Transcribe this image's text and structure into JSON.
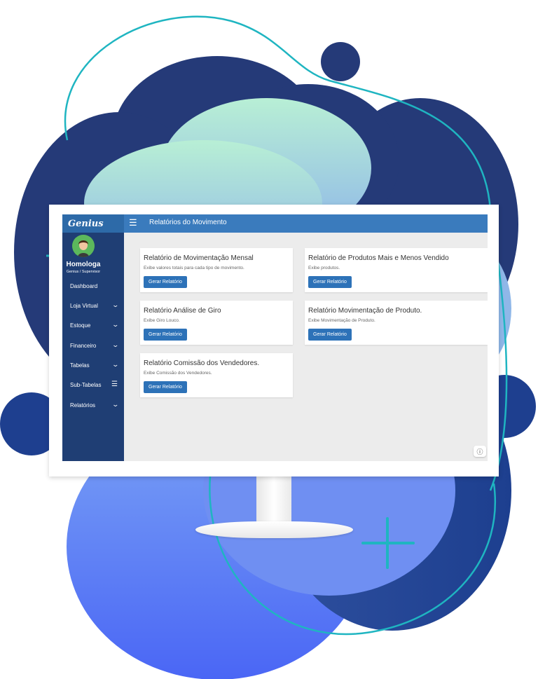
{
  "app": {
    "logo": "Genius",
    "page_title": "Relatórios do Movimento"
  },
  "user": {
    "name": "Homologa",
    "role": "Genius / Supervisor"
  },
  "sidebar": {
    "items": [
      {
        "label": "Dashboard",
        "icon": "none"
      },
      {
        "label": "Loja Virtual",
        "icon": "chevron-down-icon"
      },
      {
        "label": "Estoque",
        "icon": "chevron-down-icon"
      },
      {
        "label": "Financeiro",
        "icon": "chevron-down-icon"
      },
      {
        "label": "Tabelas",
        "icon": "chevron-down-icon"
      },
      {
        "label": "Sub-Tabelas",
        "icon": "bars-icon"
      },
      {
        "label": "Relatórios",
        "icon": "chevron-down-icon"
      }
    ]
  },
  "reports": [
    {
      "title": "Relatório de Movimentação Mensal",
      "description": "Exibe valores totais para cada tipo de movimento.",
      "button": "Gerar Relatório"
    },
    {
      "title": "Relatório de Produtos Mais e Menos Vendido",
      "description": "Exibe produtos.",
      "button": "Gerar Relatório"
    },
    {
      "title": "Relatório Análise de Giro",
      "description": "Exibe Giro Louco.",
      "button": "Gerar Relatório"
    },
    {
      "title": "Relatório Movimentação de Produto.",
      "description": "Exibe Movimentação de Produto.",
      "button": "Gerar Relatório"
    },
    {
      "title": "Relatório Comissão dos Vendedores.",
      "description": "Exibe Comissão dos Vendedores.",
      "button": "Gerar Relatório"
    }
  ],
  "colors": {
    "topbar": "#3a7bbd",
    "sidebar": "#1f3e74",
    "button": "#2d72b8",
    "content_bg": "#ececec",
    "teal_ring": "#1fb5c1"
  }
}
